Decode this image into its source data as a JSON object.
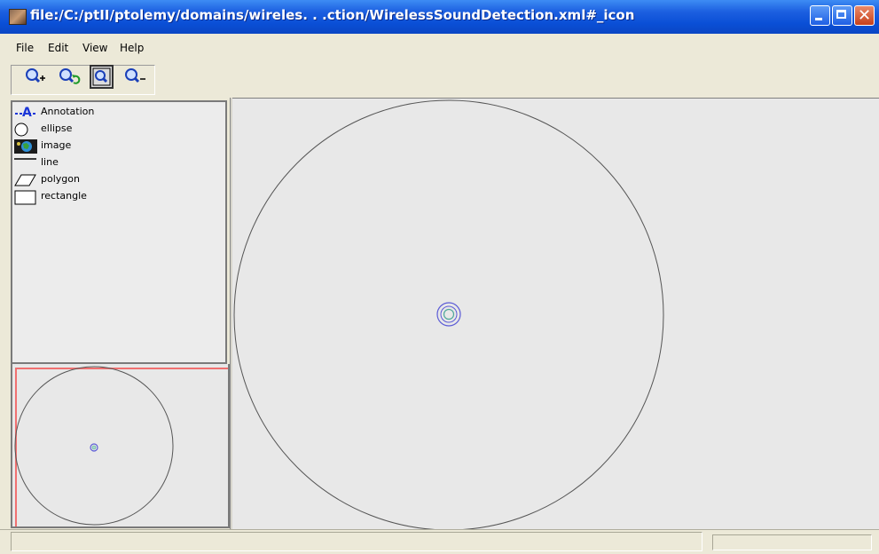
{
  "window": {
    "title": "file:/C:/ptII/ptolemy/domains/wireles. . .ction/WirelessSoundDetection.xml#_icon",
    "app_icon": "ptolemy-icon",
    "controls": {
      "minimize": "minimize-icon",
      "maximize": "maximize-icon",
      "close_glyph": "✕"
    }
  },
  "menu": [
    "File",
    "Edit",
    "View",
    "Help"
  ],
  "toolbar": {
    "buttons": [
      {
        "name": "zoom-in-button",
        "icon": "zoom-in-icon",
        "active": false
      },
      {
        "name": "zoom-reset-button",
        "icon": "zoom-reset-icon",
        "active": false
      },
      {
        "name": "zoom-fit-button",
        "icon": "zoom-fit-icon",
        "active": true
      },
      {
        "name": "zoom-out-button",
        "icon": "zoom-out-icon",
        "active": false
      }
    ]
  },
  "palette": {
    "items": [
      {
        "label": "Annotation",
        "icon": "annotation-icon"
      },
      {
        "label": "ellipse",
        "icon": "ellipse-icon"
      },
      {
        "label": "image",
        "icon": "image-icon"
      },
      {
        "label": "line",
        "icon": "line-icon"
      },
      {
        "label": "polygon",
        "icon": "polygon-icon"
      },
      {
        "label": "rectangle",
        "icon": "rectangle-icon"
      }
    ]
  },
  "canvas": {
    "shapes": [
      "large-circle",
      "sensor-ring-outer",
      "sensor-ring-inner",
      "sensor-ring-center"
    ]
  },
  "colors": {
    "titlebar": "#0a4fd6",
    "circle_stroke": "#555555",
    "sensor_outer": "#5b5bd6",
    "sensor_inner": "#4fa89a",
    "overview_viewport": "#f07070",
    "annotation_blue": "#1a35d8"
  },
  "statusbar": {
    "message": ""
  }
}
